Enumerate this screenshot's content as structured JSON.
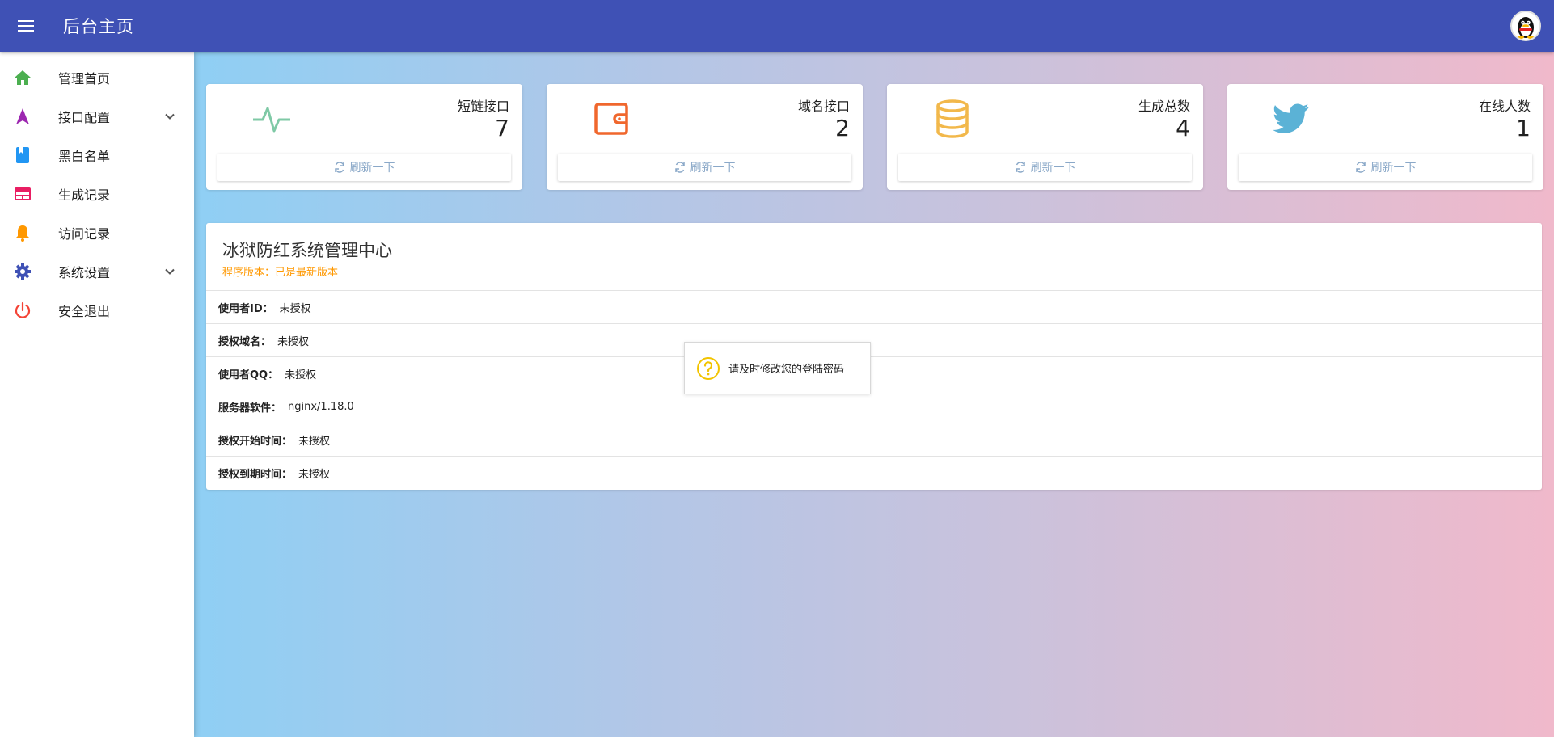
{
  "topbar": {
    "title": "后台主页"
  },
  "sidebar": {
    "items": [
      {
        "label": "管理首页",
        "icon": "home-icon",
        "color": "#4caf50"
      },
      {
        "label": "接口配置",
        "icon": "navigation-icon",
        "color": "#9c27b0",
        "expandable": true
      },
      {
        "label": "黑白名单",
        "icon": "book-icon",
        "color": "#2196f3"
      },
      {
        "label": "生成记录",
        "icon": "web-icon",
        "color": "#e91e63"
      },
      {
        "label": "访问记录",
        "icon": "bell-icon",
        "color": "#ff9800"
      },
      {
        "label": "系统设置",
        "icon": "gear-icon",
        "color": "#3f51b5",
        "expandable": true
      },
      {
        "label": "安全退出",
        "icon": "power-icon",
        "color": "#f44336"
      }
    ]
  },
  "cards": [
    {
      "label": "短链接口",
      "value": "7",
      "icon": "pulse-icon",
      "color": "#7fc9a6",
      "refresh": "刷新一下"
    },
    {
      "label": "域名接口",
      "value": "2",
      "icon": "wallet-icon",
      "color": "#f0672d",
      "refresh": "刷新一下"
    },
    {
      "label": "生成总数",
      "value": "4",
      "icon": "database-icon",
      "color": "#f2b84b",
      "refresh": "刷新一下"
    },
    {
      "label": "在线人数",
      "value": "1",
      "icon": "twitter-icon",
      "color": "#5bb2d6",
      "refresh": "刷新一下"
    }
  ],
  "panel": {
    "title": "冰狱防红系统管理中心",
    "version_label": "程序版本：",
    "version_value": "已是最新版本",
    "rows": [
      {
        "key": "使用者ID：",
        "value": "未授权"
      },
      {
        "key": "授权域名：",
        "value": "未授权"
      },
      {
        "key": "使用者QQ：",
        "value": "未授权"
      },
      {
        "key": "服务器软件：",
        "value": "nginx/1.18.0"
      },
      {
        "key": "授权开始时间：",
        "value": "未授权"
      },
      {
        "key": "授权到期时间：",
        "value": "未授权"
      }
    ]
  },
  "toast": {
    "text": "请及时修改您的登陆密码",
    "icon": "question-icon",
    "color": "#f2c400"
  }
}
